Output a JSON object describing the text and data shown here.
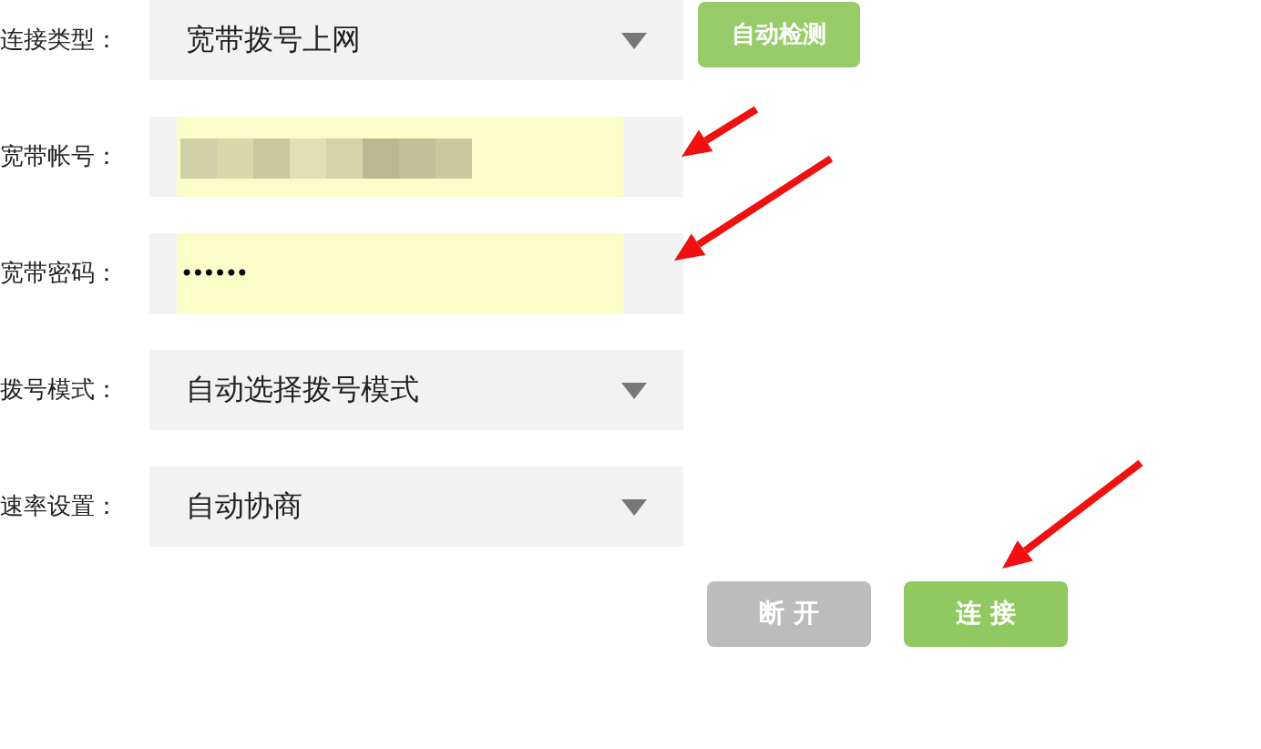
{
  "fields": [
    {
      "label": "连接类型：",
      "kind": "select",
      "value": "宽带拨号上网",
      "button": "自动检测"
    },
    {
      "label": "宽带帐号：",
      "kind": "redacted"
    },
    {
      "label": "宽带密码：",
      "kind": "password",
      "value": "••••••"
    },
    {
      "label": "拨号模式：",
      "kind": "select",
      "value": "自动选择拨号模式"
    },
    {
      "label": "速率设置：",
      "kind": "select",
      "value": "自动协商"
    }
  ],
  "buttons": [
    {
      "label": "断 开",
      "kind": "secondary"
    },
    {
      "label": "连 接",
      "kind": "primary"
    }
  ]
}
